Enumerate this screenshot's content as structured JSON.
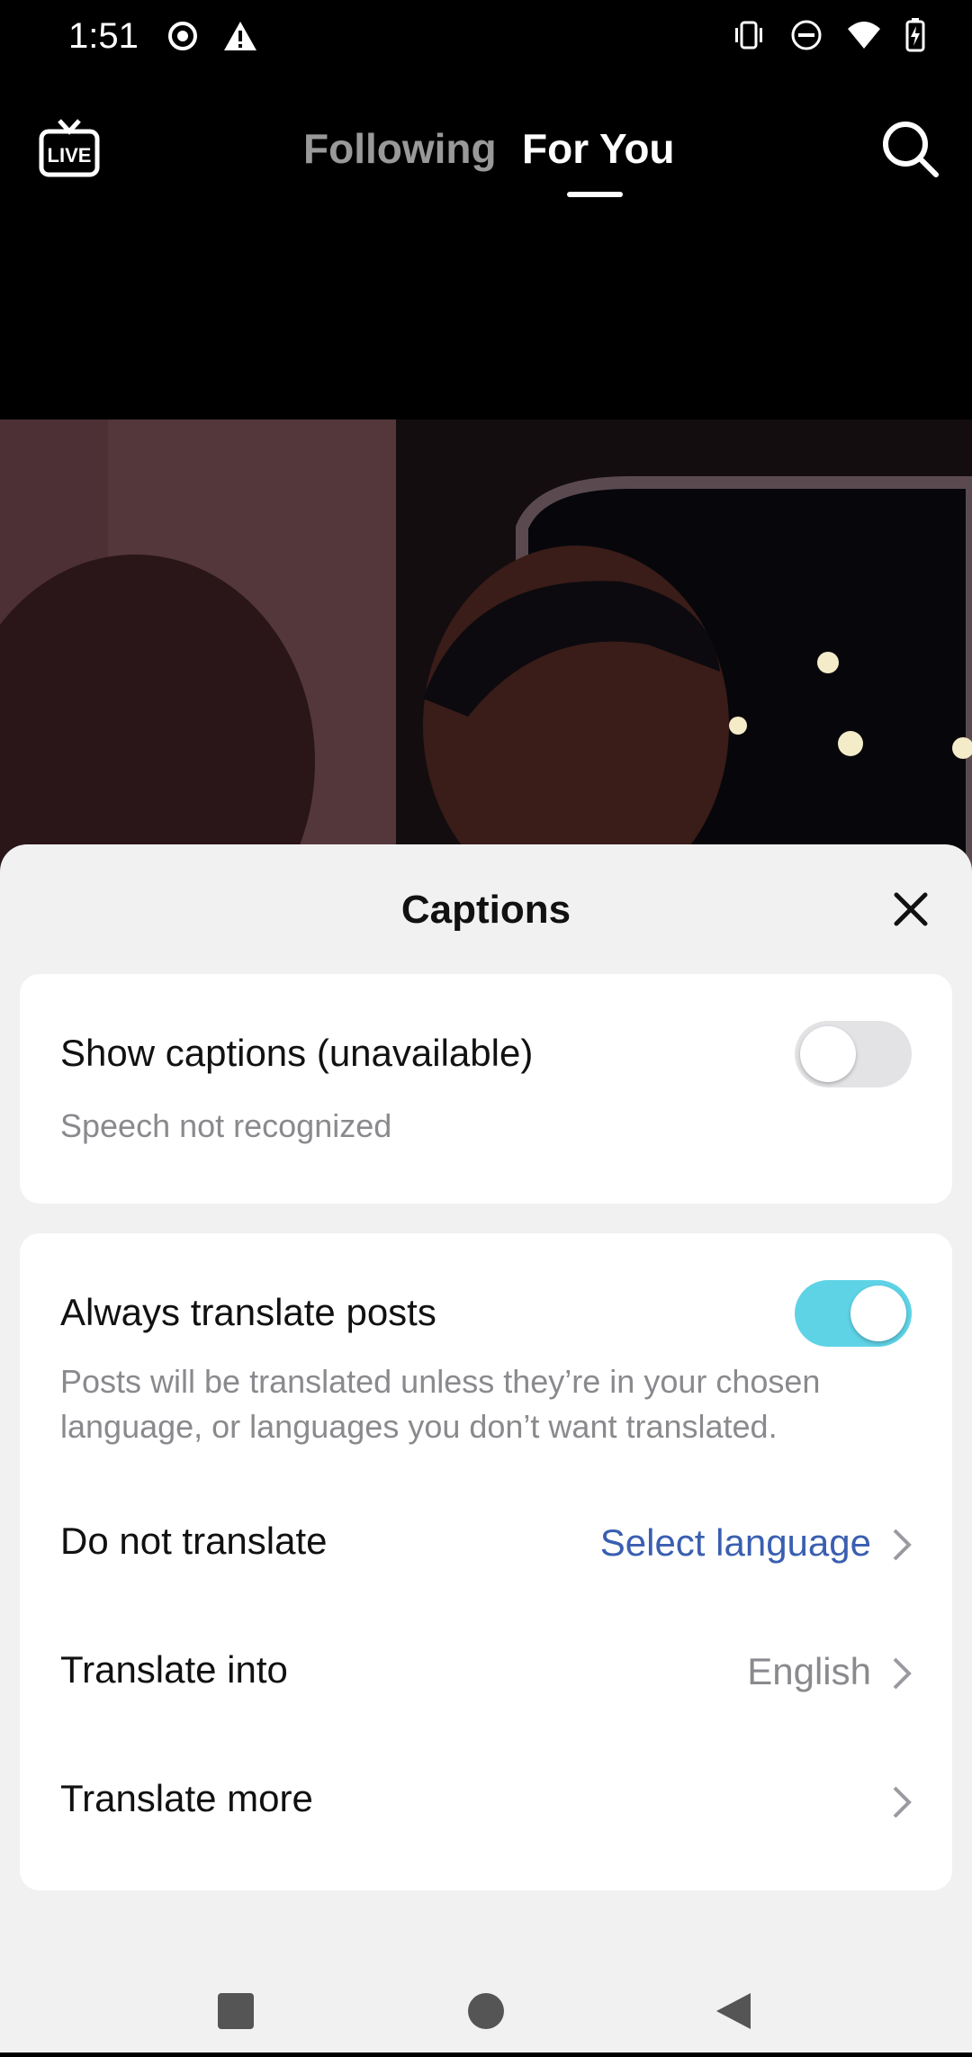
{
  "status_bar": {
    "time": "1:51"
  },
  "top_nav": {
    "tabs": [
      {
        "label": "Following"
      },
      {
        "label": "For You"
      }
    ]
  },
  "sheet": {
    "title": "Captions",
    "show_captions": {
      "label": "Show captions (unavailable)",
      "sublabel": "Speech not recognized",
      "enabled": false
    },
    "always_translate": {
      "label": "Always translate posts",
      "description_line1": "Posts will be translated unless they’re in your chosen",
      "description_line2": "language, or languages you don’t want translated.",
      "enabled": true
    },
    "do_not_translate": {
      "label": "Do not translate",
      "value": "Select language"
    },
    "translate_into": {
      "label": "Translate into",
      "value": "English"
    },
    "translate_more": {
      "label": "Translate more"
    }
  },
  "colors": {
    "accent_link": "#3a5fb0",
    "toggle_on": "#5fd3e6",
    "toggle_off": "#e3e3e6"
  }
}
